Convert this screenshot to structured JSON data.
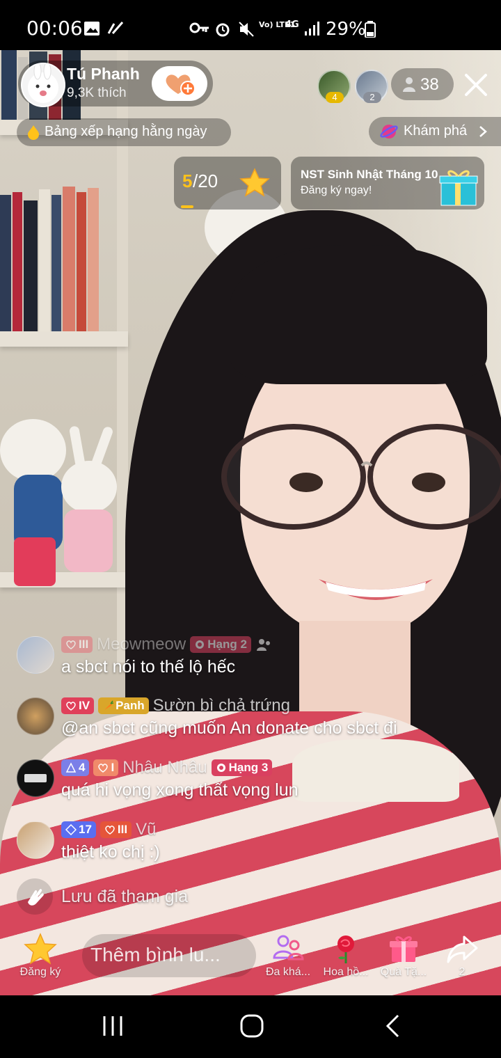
{
  "status_bar": {
    "time": "00:06",
    "signal_text": "Vo) LTE1",
    "network": "4G",
    "battery": "29%"
  },
  "host": {
    "name": "Tú Phanh",
    "likes": "9,3K thích"
  },
  "viewers": {
    "top": [
      {
        "badge": "4",
        "badge_color": "#e6b800"
      },
      {
        "badge": "2",
        "badge_color": "#8a8f99"
      }
    ],
    "count": "38"
  },
  "ranking": {
    "label": "Bảng xếp hạng hằng ngày"
  },
  "explore": {
    "label": "Khám phá"
  },
  "goal": {
    "current": "5",
    "separator": "/20"
  },
  "event": {
    "title": "NST Sinh Nhật Tháng 10",
    "subtitle": "Đăng ký ngay!"
  },
  "comments": [
    {
      "user": "Meowmeow",
      "badges": [
        {
          "text": "III",
          "color": "#e5707a"
        }
      ],
      "rank_badge": "Hạng 2",
      "text": "a sbct nói to thế lộ hếc"
    },
    {
      "user": "Sườn bì chả trứng",
      "badges": [
        {
          "text": "IV",
          "color": "#e0405a"
        },
        {
          "text": "Panh",
          "color": "#d9a62a"
        }
      ],
      "text": "@an sbct cũng muốn An donate cho sbct đi"
    },
    {
      "user": "Nhâu Nhâu",
      "badges": [
        {
          "text": "4",
          "color": "#7b7fe8"
        },
        {
          "text": "I",
          "color": "#f08a6a"
        }
      ],
      "rank_badge": "Hạng 3",
      "text": "quá hi vọng xong thất vọng lun"
    },
    {
      "user": "Vũ",
      "badges": [
        {
          "text": "17",
          "color": "#5a6ef0"
        },
        {
          "text": "III",
          "color": "#e5553a"
        }
      ],
      "text": "thiệt ko chị :)"
    }
  ],
  "join_message": "Lưu đã tham gia",
  "bottom": {
    "subscribe": "Đăng ký",
    "comment_placeholder": "Thêm bình lu...",
    "multi_guest": "Đa khá...",
    "rose": "Hoa hồ...",
    "gift": "Quà Tặ...",
    "share_count": "2"
  }
}
